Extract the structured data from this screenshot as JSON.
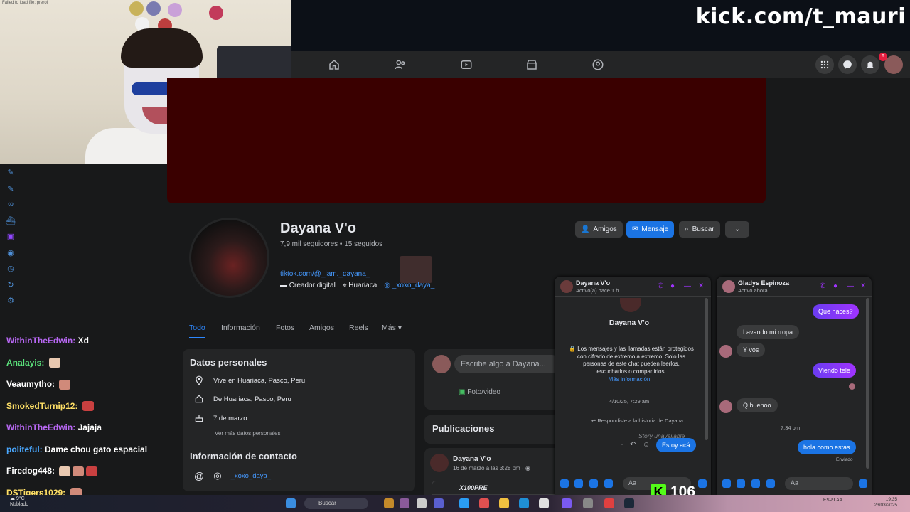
{
  "webcam": {
    "error_text": "Failed to load file: preroll"
  },
  "stream": {
    "url": "kick.com/t_mauri",
    "viewer_count": "106"
  },
  "fb_nav": {
    "notifications_count": "5"
  },
  "profile": {
    "name": "Dayana V'o",
    "stats": "7,9 mil seguidores • 15 seguidos",
    "link": "tiktok.com/@_iam._dayana_",
    "category": "Creador digital",
    "location": "Huariaca",
    "instagram": "_xoxo_daya_",
    "buttons": {
      "friends": "Amigos",
      "message": "Mensaje",
      "search": "Buscar"
    }
  },
  "tabs": [
    "Todo",
    "Información",
    "Fotos",
    "Amigos",
    "Reels",
    "Más"
  ],
  "personal": {
    "title": "Datos personales",
    "lives_in": "Vive en Huariaca, Pasco, Peru",
    "from": "De Huariaca, Pasco, Peru",
    "birthday": "7 de marzo",
    "more": "Ver más datos personales",
    "contact_title": "Información de contacto",
    "contact_instagram": "_xoxo_daya_"
  },
  "composer": {
    "placeholder": "Escribe algo a Dayana...",
    "photo_video": "Foto/video"
  },
  "publications": {
    "title": "Publicaciones",
    "author": "Dayana V'o",
    "date": "16 de marzo a las 3:28 pm · ",
    "preview": "X100PRE"
  },
  "chat1": {
    "name": "Dayana V'o",
    "status": "Activo(a) hace 1 h",
    "profile_name": "Dayana V'o",
    "encryption_notice": "🔒 Los mensajes y las llamadas están protegidos con cifrado de extremo a extremo. Solo las personas de este chat pueden leerlos, escucharlos o compartirlos.",
    "more_info": "Más información",
    "timestamp": "4/10/25, 7:29 am",
    "story_reply": "Respondiste a la historia de Dayana",
    "story_unavailable": "Story unavailable",
    "message": "Estoy acá",
    "input_placeholder": "Aa"
  },
  "chat2": {
    "name": "Gladys Espinoza",
    "status": "Activo ahora",
    "messages": [
      {
        "from": "me",
        "text": "Que haces?"
      },
      {
        "from": "them",
        "text": "Lavando mi rropa"
      },
      {
        "from": "them",
        "text": "Y vos"
      },
      {
        "from": "me",
        "text": "Viendo tele"
      },
      {
        "from": "them",
        "text": "Q buenoo"
      },
      {
        "from": "me",
        "text": "hola como estas"
      }
    ],
    "time": "7:34 pm",
    "sent": "Enviado",
    "input_placeholder": "Aa"
  },
  "stream_chat": [
    {
      "user": "WithinTheEdwin",
      "color": "#b968f5",
      "msg": "Xd"
    },
    {
      "user": "Analayis",
      "color": "#5be37c",
      "msg": ""
    },
    {
      "user": "Veaumytho",
      "color": "#ffffff",
      "msg": ""
    },
    {
      "user": "SmokedTurnip12",
      "color": "#ffe066",
      "msg": ""
    },
    {
      "user": "WithinTheEdwin",
      "color": "#b968f5",
      "msg": "Jajaja"
    },
    {
      "user": "politeful",
      "color": "#4aa8ff",
      "msg": "Dame chou gato espacial"
    },
    {
      "user": "Firedog448",
      "color": "#ffffff",
      "msg": ""
    },
    {
      "user": "DSTigers1029",
      "color": "#ffe066",
      "msg": ""
    }
  ],
  "taskbar": {
    "weather_temp": "9°C",
    "weather_desc": "Nublado",
    "search": "Buscar",
    "lang": "ESP LAA",
    "time": "19:35",
    "date": "23/03/2025"
  }
}
